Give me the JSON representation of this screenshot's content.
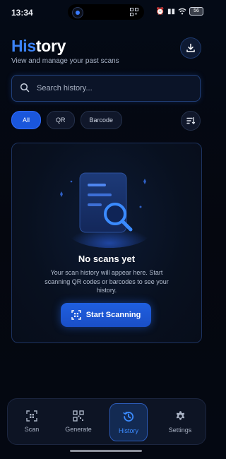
{
  "status": {
    "time": "13:34",
    "battery": "56"
  },
  "header": {
    "title_accent": "His",
    "title_rest": "tory",
    "subtitle": "View and manage your past scans"
  },
  "search": {
    "placeholder": "Search history..."
  },
  "filters": [
    {
      "label": "All",
      "active": true
    },
    {
      "label": "QR",
      "active": false
    },
    {
      "label": "Barcode",
      "active": false
    }
  ],
  "empty_state": {
    "title": "No scans yet",
    "description": "Your scan history will appear here. Start scanning QR codes or barcodes to see your history.",
    "button_label": "Start Scanning"
  },
  "tabs": [
    {
      "label": "Scan",
      "icon": "scan-icon",
      "active": false
    },
    {
      "label": "Generate",
      "icon": "qr-code-icon",
      "active": false
    },
    {
      "label": "History",
      "icon": "history-icon",
      "active": true
    },
    {
      "label": "Settings",
      "icon": "gear-icon",
      "active": false
    }
  ],
  "colors": {
    "accent": "#3b82f6",
    "background": "#05070f",
    "button": "#1a56db"
  }
}
